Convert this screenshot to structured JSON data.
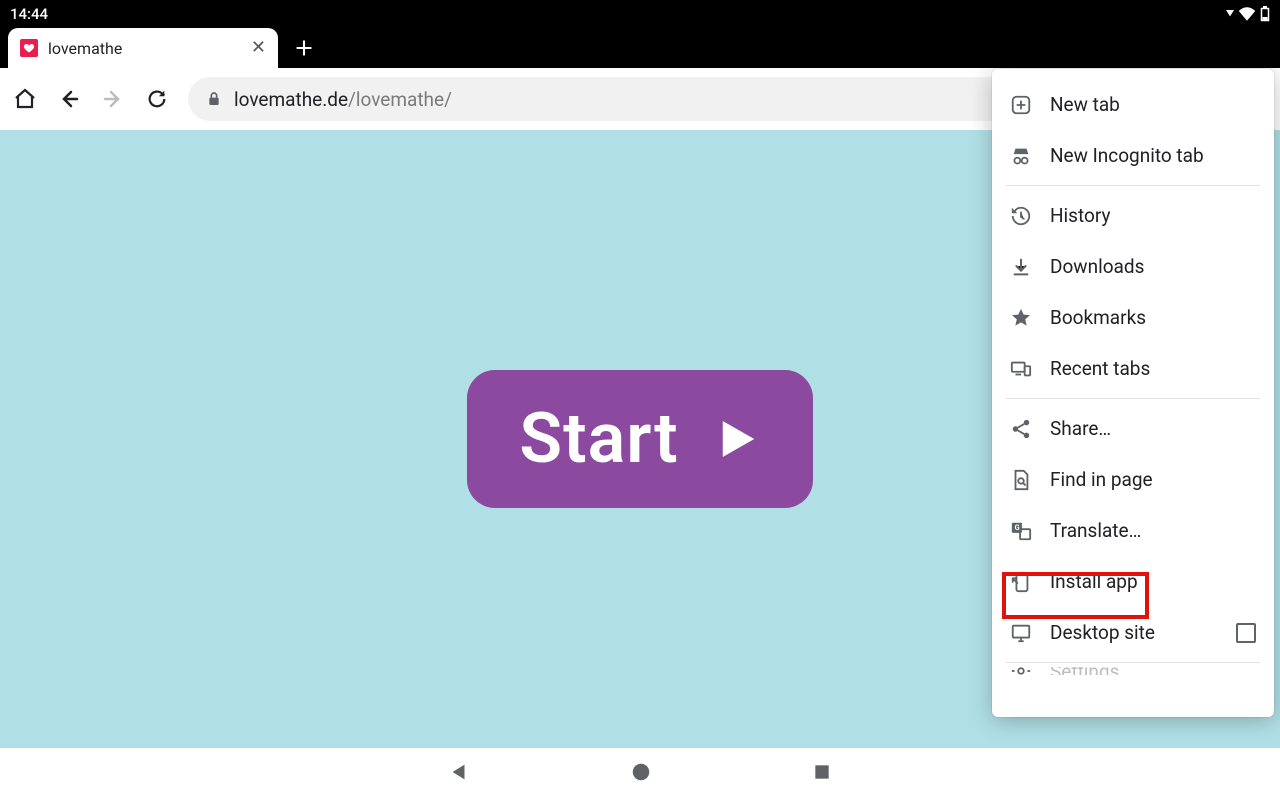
{
  "status": {
    "time": "14:44"
  },
  "tab": {
    "title": "lovemathe"
  },
  "url": {
    "host": "lovemathe.de",
    "path": "/lovemathe/"
  },
  "page": {
    "start_label": "Start"
  },
  "menu": {
    "new_tab": "New tab",
    "incognito": "New Incognito tab",
    "history": "History",
    "downloads": "Downloads",
    "bookmarks": "Bookmarks",
    "recent_tabs": "Recent tabs",
    "share": "Share…",
    "find": "Find in page",
    "translate": "Translate…",
    "install": "Install app",
    "desktop": "Desktop site",
    "settings": "Settings"
  }
}
